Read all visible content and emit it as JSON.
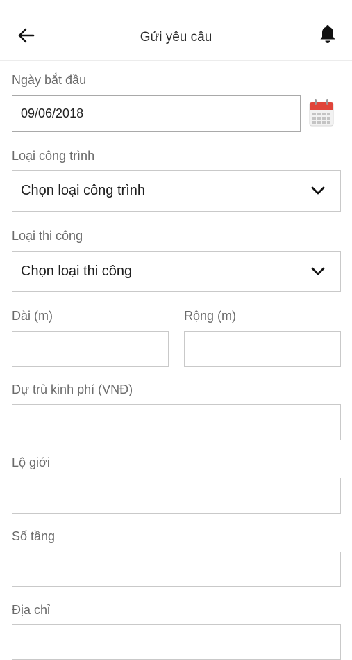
{
  "header": {
    "title": "Gửi yêu cầu"
  },
  "form": {
    "start_date": {
      "label": "Ngày bắt đầu",
      "value": "09/06/2018"
    },
    "project_type": {
      "label": "Loại công trình",
      "selected": "Chọn loại công trình"
    },
    "construction_type": {
      "label": "Loại thi công",
      "selected": "Chọn loại thi công"
    },
    "length": {
      "label": "Dài (m)",
      "value": ""
    },
    "width": {
      "label": "Rộng (m)",
      "value": ""
    },
    "budget": {
      "label": "Dự trù kinh phí (VNĐ)",
      "value": ""
    },
    "setback": {
      "label": "Lộ giới",
      "value": ""
    },
    "floors": {
      "label": "Số tầng",
      "value": ""
    },
    "address": {
      "label": "Địa chỉ",
      "value": ""
    }
  },
  "icons": {
    "back": "arrow-left-icon",
    "notification": "bell-icon",
    "calendar": "calendar-icon",
    "dropdown": "chevron-down-icon"
  },
  "colors": {
    "calendar_header": "#e0453a",
    "border": "#c9c9c9"
  }
}
